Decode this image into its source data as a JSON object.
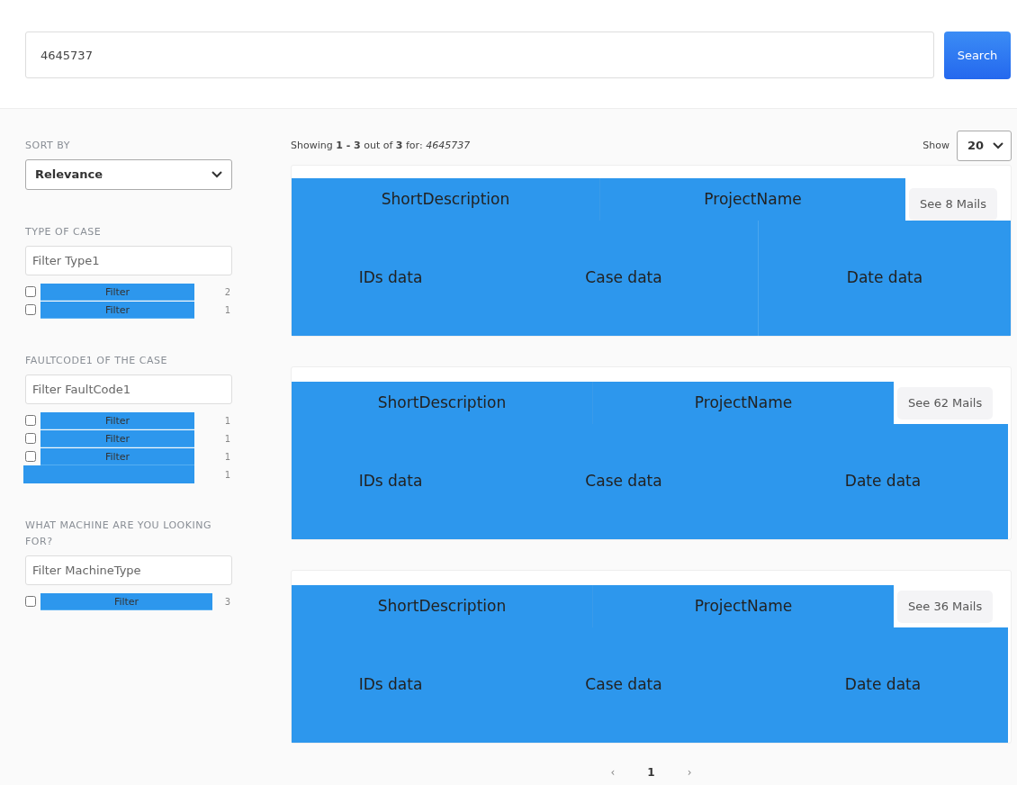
{
  "search": {
    "value": "4645737",
    "button": "Search"
  },
  "sidebar": {
    "sort": {
      "title": "SORT BY",
      "value": "Relevance"
    },
    "facets": [
      {
        "title": "TYPE OF CASE",
        "placeholder": "Filter Type1",
        "wide": false,
        "options": [
          {
            "kind": "option",
            "label": "Filter",
            "count": "2",
            "checked": false
          },
          {
            "kind": "option",
            "label": "Filter",
            "count": "1",
            "checked": false
          }
        ]
      },
      {
        "title": "FAULTCODE1 OF THE CASE",
        "placeholder": "Filter FaultCode1",
        "wide": false,
        "options": [
          {
            "kind": "option",
            "label": "Filter",
            "count": "1",
            "checked": false
          },
          {
            "kind": "option",
            "label": "Filter",
            "count": "1",
            "checked": false
          },
          {
            "kind": "option",
            "label": "Filter",
            "count": "1",
            "checked": false
          },
          {
            "kind": "bare",
            "count": "1"
          }
        ]
      },
      {
        "title": "WHAT MACHINE ARE YOU LOOKING FOR?",
        "placeholder": "Filter MachineType",
        "wide": true,
        "options": [
          {
            "kind": "option",
            "label": "Filter",
            "count": "3",
            "checked": false
          }
        ]
      }
    ]
  },
  "results": {
    "summary": "Showing **1 - 3** out of **3** for: *4645737*",
    "show_label": "Show",
    "page_size": "20",
    "cards": [
      {
        "short_description": "ShortDescription",
        "project_name": "ProjectName",
        "mails_button": "See 8 Mails",
        "ids": "IDs data",
        "case": "Case data",
        "date": "Date data",
        "full": true
      },
      {
        "short_description": "ShortDescription",
        "project_name": "ProjectName",
        "mails_button": "See 62 Mails",
        "ids": "IDs data",
        "case": "Case data",
        "date": "Date data",
        "full": false
      },
      {
        "short_description": "ShortDescription",
        "project_name": "ProjectName",
        "mails_button": "See 36 Mails",
        "ids": "IDs data",
        "case": "Case data",
        "date": "Date data",
        "full": false
      }
    ]
  },
  "pagination": [
    {
      "label": "‹",
      "disabled": true,
      "selected": false
    },
    {
      "label": "1",
      "disabled": false,
      "selected": true
    },
    {
      "label": "›",
      "disabled": true,
      "selected": false
    }
  ]
}
